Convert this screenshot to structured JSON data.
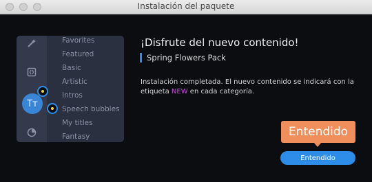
{
  "window": {
    "title": "Instalación del paquete"
  },
  "sidebar": {
    "rail_icons": [
      "wand-icon",
      "brackets-icon",
      "text-icon",
      "clock-icon"
    ],
    "text_icon_glyph": "Tт",
    "items": [
      {
        "label": "Favorites"
      },
      {
        "label": "Featured"
      },
      {
        "label": "Basic"
      },
      {
        "label": "Artistic"
      },
      {
        "label": "Intros"
      },
      {
        "label": "Speech bubbles"
      },
      {
        "label": "My titles"
      },
      {
        "label": "Fantasy"
      }
    ]
  },
  "content": {
    "headline": "¡Disfrute del nuevo contenido!",
    "pack_name": "Spring Flowers Pack",
    "message_before": "Instalación completada. El nuevo contenido se indicará con la etiqueta ",
    "message_tag": "NEW",
    "message_after": " en cada categoría."
  },
  "tooltip": {
    "label": "Entendido"
  },
  "actions": {
    "ok_label": "Entendido"
  },
  "colors": {
    "accent": "#2d8de8",
    "callout": "#f08e5c",
    "new_tag": "#c84ae0"
  }
}
